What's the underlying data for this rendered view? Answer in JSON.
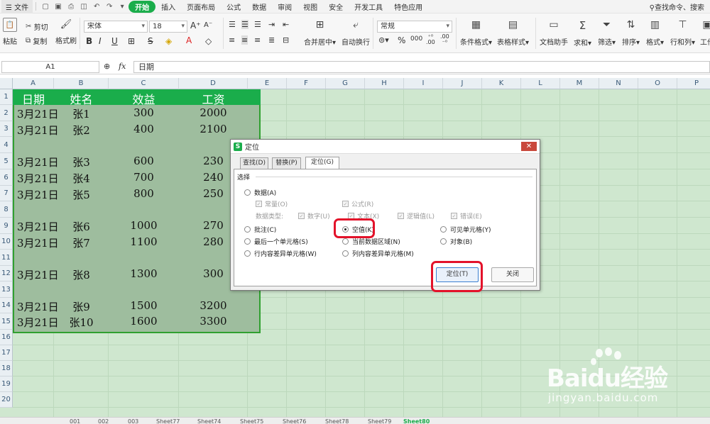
{
  "menubar": {
    "file": "文件",
    "tabs": [
      "开始",
      "插入",
      "页面布局",
      "公式",
      "数据",
      "审阅",
      "视图",
      "安全",
      "开发工具",
      "特色应用"
    ],
    "search": "查找命令、搜索"
  },
  "ribbon": {
    "paste": "粘贴",
    "cut": "剪切",
    "copy": "复制",
    "format_painter": "格式刷",
    "font_name": "宋体",
    "font_size": "18",
    "number_format": "常规",
    "merge_center": "合并居中",
    "wrap_text": "自动换行",
    "conditional_format": "条件格式",
    "table_style": "表格样式",
    "doc_helper": "文档助手",
    "sum": "求和",
    "filter": "筛选",
    "sort": "排序",
    "format": "格式",
    "row_col": "行和列",
    "worksheet": "工作"
  },
  "formula_bar": {
    "name_box": "A1",
    "fx_label": "fx",
    "value": "日期"
  },
  "grid": {
    "columns": [
      "A",
      "B",
      "C",
      "D",
      "E",
      "F",
      "G",
      "H",
      "I",
      "J",
      "K",
      "L",
      "M",
      "N",
      "O",
      "P"
    ],
    "rows": [
      "1",
      "2",
      "3",
      "4",
      "5",
      "6",
      "7",
      "8",
      "9",
      "10",
      "11",
      "12",
      "13",
      "14",
      "15",
      "16",
      "17",
      "18",
      "19",
      "20"
    ],
    "header": [
      "日期",
      "姓名",
      "效益",
      "工资"
    ],
    "data": [
      [
        "3月21日",
        "张1",
        "300",
        "2000"
      ],
      [
        "3月21日",
        "张2",
        "400",
        "2100"
      ],
      [
        "",
        "",
        "",
        ""
      ],
      [
        "3月21日",
        "张3",
        "600",
        "230"
      ],
      [
        "3月21日",
        "张4",
        "700",
        "240"
      ],
      [
        "3月21日",
        "张5",
        "800",
        "250"
      ],
      [
        "",
        "",
        "",
        ""
      ],
      [
        "3月21日",
        "张6",
        "1000",
        "270"
      ],
      [
        "3月21日",
        "张7",
        "1100",
        "280"
      ],
      [
        "",
        "",
        "",
        ""
      ],
      [
        "3月21日",
        "张8",
        "1300",
        "300"
      ],
      [
        "",
        "",
        "",
        ""
      ],
      [
        "3月21日",
        "张9",
        "1500",
        "3200"
      ],
      [
        "3月21日",
        "张10",
        "1600",
        "3300"
      ]
    ]
  },
  "sheet_tabs": [
    "001",
    "002",
    "003",
    "Sheet77",
    "Sheet74",
    "Sheet75",
    "Sheet76",
    "Sheet78",
    "Sheet79",
    "Sheet80"
  ],
  "dialog": {
    "title": "定位",
    "tabs": [
      "查找(D)",
      "替换(P)",
      "定位(G)"
    ],
    "group_label": "选择",
    "opt_data": "数据(A)",
    "opt_constant": "常量(O)",
    "opt_formula": "公式(R)",
    "data_type_label": "数据类型:",
    "type_number": "数字(U)",
    "type_text": "文本(X)",
    "type_logical": "逻辑值(L)",
    "type_error": "错误(E)",
    "opt_comment": "批注(C)",
    "opt_blank": "空值(K)",
    "opt_visible": "可见单元格(Y)",
    "opt_last_cell": "最后一个单元格(S)",
    "opt_current_region": "当前数据区域(N)",
    "opt_object": "对象(B)",
    "opt_row_diff": "行内容差异单元格(W)",
    "opt_col_diff": "列内容差异单元格(M)",
    "btn_goto": "定位(T)",
    "btn_close": "关闭"
  },
  "watermark": {
    "brand": "Baidu经验",
    "url": "jingyan.baidu.com"
  },
  "colors": {
    "accent": "#1aad4b",
    "highlight": "#e3122a",
    "grid_bg": "#cfe7cf"
  }
}
